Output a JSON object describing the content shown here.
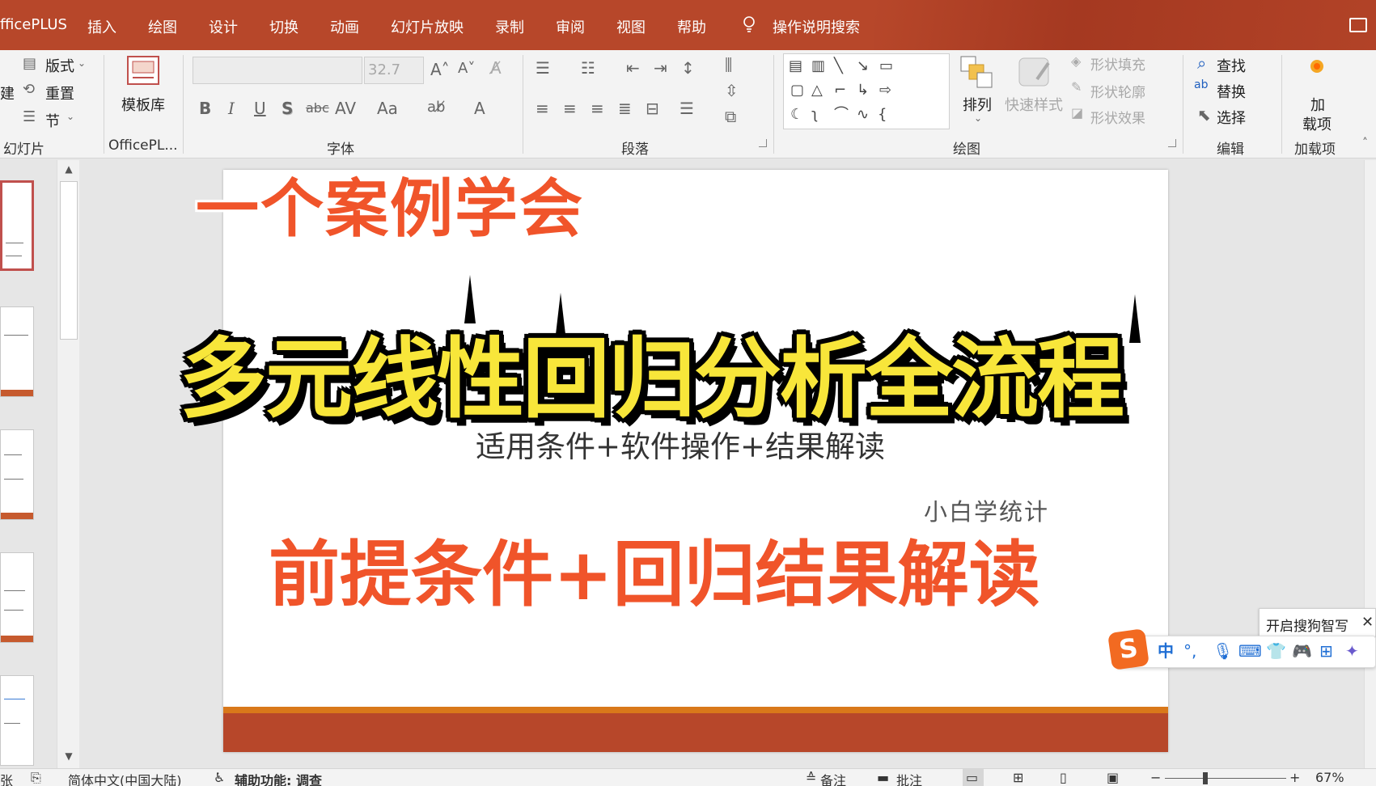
{
  "menubar": {
    "app_name": "fficePLUS",
    "tabs": [
      "插入",
      "绘图",
      "设计",
      "切换",
      "动画",
      "幻灯片放映",
      "录制",
      "审阅",
      "视图",
      "帮助"
    ],
    "search": "操作说明搜索"
  },
  "ribbon": {
    "slides_group": {
      "layout": "版式",
      "reset": "重置",
      "section": "节",
      "new_partial": "建",
      "label": "幻灯片"
    },
    "officeplus_group": {
      "template": "模板库",
      "label": "OfficePL..."
    },
    "font_group": {
      "font_size": "32.7",
      "label": "字体",
      "buttons": [
        "B",
        "I",
        "U",
        "S",
        "abc",
        "AV",
        "Aa",
        "A"
      ]
    },
    "paragraph_group": {
      "label": "段落"
    },
    "drawing_group": {
      "arrange": "排列",
      "quick_styles": "快速样式",
      "shape_fill": "形状填充",
      "shape_outline": "形状轮廓",
      "shape_effects": "形状效果",
      "label": "绘图"
    },
    "editing_group": {
      "find": "查找",
      "replace": "替换",
      "select": "选择",
      "label": "编辑"
    },
    "addins_group": {
      "addins_line1": "加",
      "addins_line2": "载项",
      "label": "加载项"
    }
  },
  "slide": {
    "subtitle": "适用条件+软件操作+结果解读",
    "author": "小白学统计"
  },
  "overlay": {
    "top_caption": "一个案例学会",
    "main_title": "多元线性回归分析全流程",
    "bottom_caption": "前提条件+回归结果解读"
  },
  "ime": {
    "tip": "开启搜狗智写",
    "logo": "S",
    "mode": "中",
    "punct": "°,"
  },
  "statusbar": {
    "slide_partial": "张",
    "language": "简体中文(中国大陆)",
    "accessibility": "辅助功能: 调查",
    "notes": "备注",
    "comments": "批注",
    "zoom": "67%"
  },
  "colors": {
    "accent": "#b7472a",
    "overlay_red": "#f0542a",
    "overlay_yellow": "#f8e63a",
    "slide_orange_line": "#d9781a"
  }
}
